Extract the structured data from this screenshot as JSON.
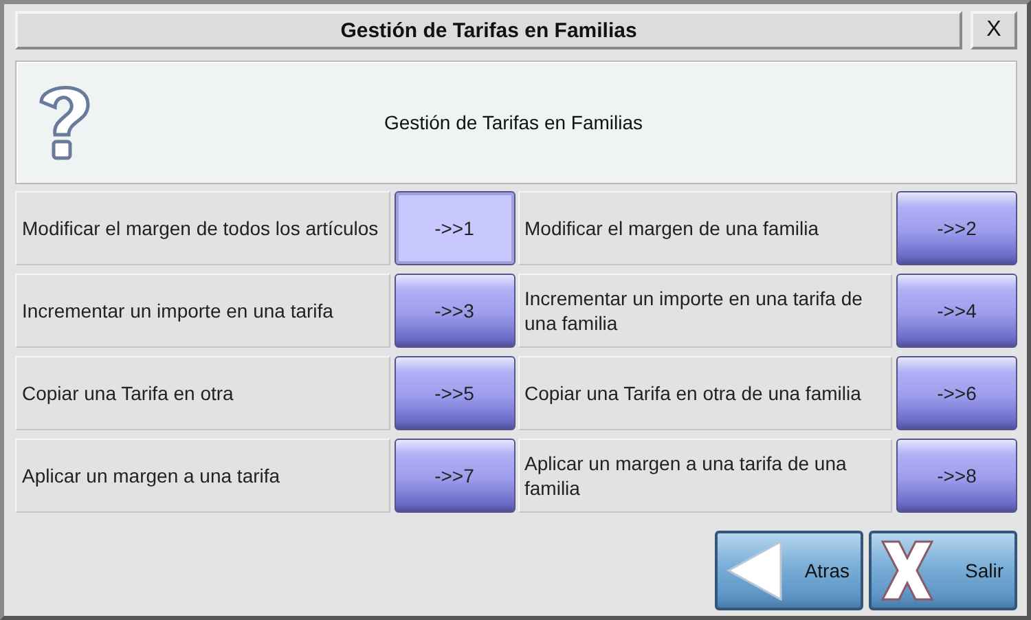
{
  "window": {
    "title": "Gestión de Tarifas en Familias",
    "close": "X"
  },
  "header": {
    "message": "Gestión de Tarifas en Familias"
  },
  "rows": [
    {
      "options": [
        {
          "label": "Modificar el margen de todos los artículos",
          "button": "->>1",
          "selected": true
        },
        {
          "label": "Modificar el margen de una familia",
          "button": "->>2",
          "selected": false
        }
      ]
    },
    {
      "options": [
        {
          "label": "Incrementar un importe en una tarifa",
          "button": "->>3",
          "selected": false
        },
        {
          "label": "Incrementar un importe en una tarifa de una familia",
          "button": "->>4",
          "selected": false
        }
      ]
    },
    {
      "options": [
        {
          "label": "Copiar una Tarifa en otra",
          "button": "->>5",
          "selected": false
        },
        {
          "label": "Copiar una Tarifa en otra de una familia",
          "button": "->>6",
          "selected": false
        }
      ]
    },
    {
      "options": [
        {
          "label": "Aplicar un margen a una tarifa",
          "button": "->>7",
          "selected": false
        },
        {
          "label": "Aplicar un margen a una tarifa de una familia",
          "button": "->>8",
          "selected": false
        }
      ]
    }
  ],
  "footer_buttons": [
    {
      "kind": "back",
      "label": "Atras"
    },
    {
      "kind": "exit",
      "label": "Salir"
    }
  ]
}
